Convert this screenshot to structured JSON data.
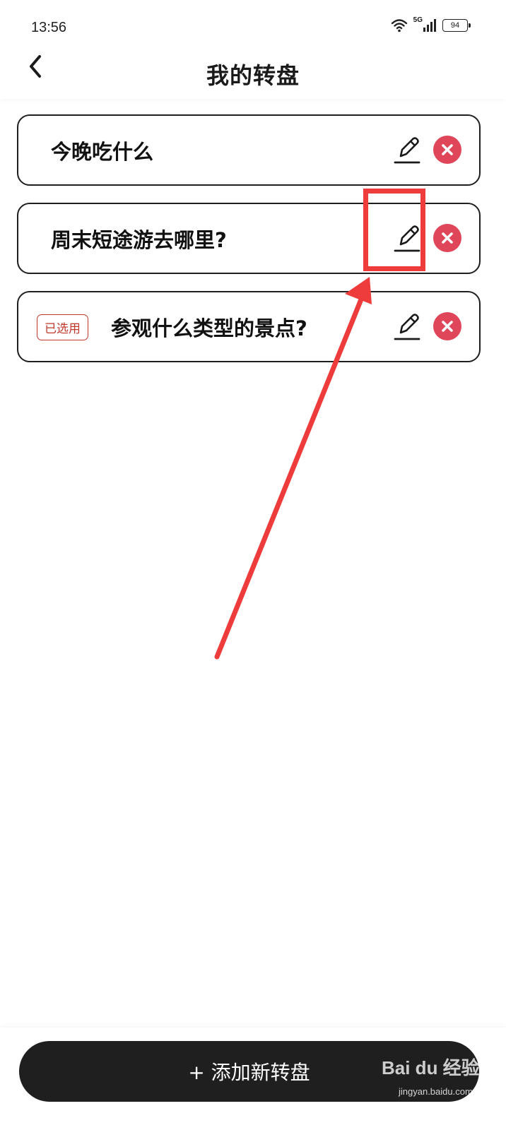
{
  "status_bar": {
    "time": "13:56",
    "network_label": "5G",
    "battery_level": "94",
    "icons": [
      "wifi-icon",
      "cellular-signal-icon",
      "battery-icon"
    ]
  },
  "header": {
    "title": "我的转盘",
    "back_icon": "chevron-left-icon"
  },
  "wheels": [
    {
      "name": "今晚吃什么",
      "selected": false
    },
    {
      "name": "周末短途游去哪里?",
      "selected": false
    },
    {
      "name": "参观什么类型的景点?",
      "selected": true,
      "badge": "已选用"
    }
  ],
  "row_icons": {
    "edit": "pencil-icon",
    "delete": "close-circle-icon"
  },
  "footer": {
    "add_button_label": "+ 添加新转盘"
  },
  "watermark": {
    "brand": "Bai du 经验",
    "url": "jingyan.baidu.com"
  },
  "colors": {
    "delete_red": "#e0465a",
    "badge_red": "#c0392b",
    "annotation_red": "#ee3b3b",
    "button_dark": "#1f1f1f"
  }
}
